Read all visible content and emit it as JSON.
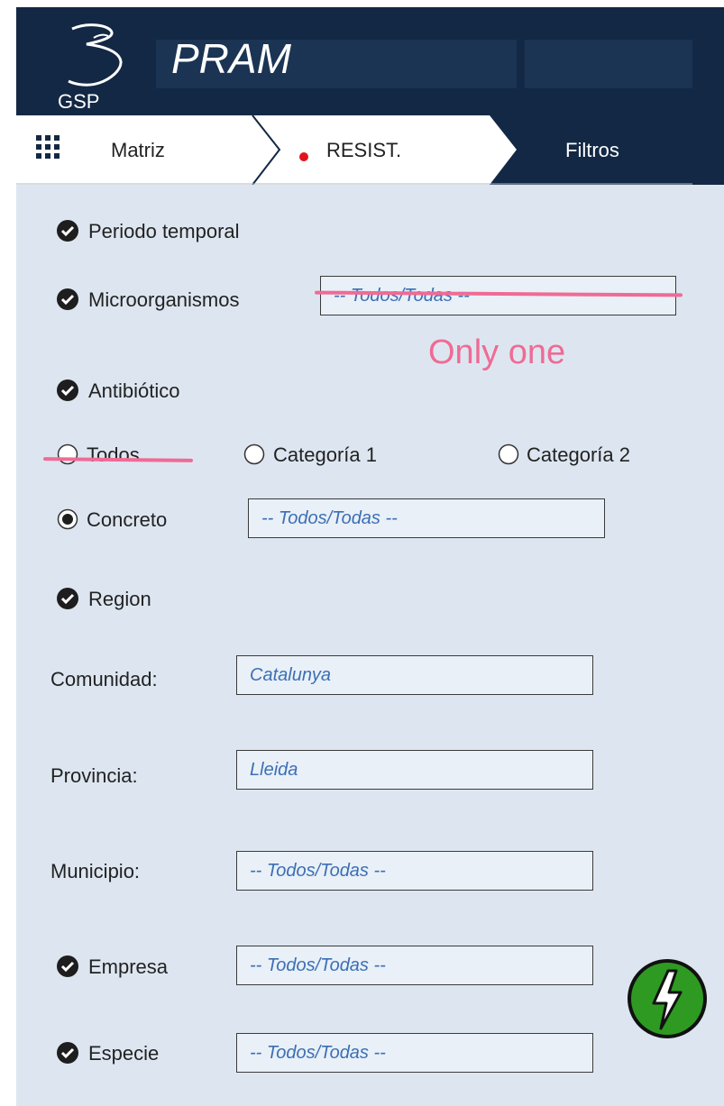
{
  "header": {
    "logo_text": "GSP",
    "title": "PRAM"
  },
  "breadcrumb": {
    "items": [
      {
        "label": "Matriz"
      },
      {
        "label": "RESIST."
      },
      {
        "label": "Filtros"
      }
    ]
  },
  "filters": {
    "periodo_label": "Periodo temporal",
    "microorganismos": {
      "label": "Microorganismos",
      "value": "-- Todos/Todas --"
    },
    "antibiotico_label": "Antibiótico",
    "antibiotico_options": [
      {
        "label": "Todos",
        "selected": false
      },
      {
        "label": "Categoría 1",
        "selected": false
      },
      {
        "label": "Categoría 2",
        "selected": false
      },
      {
        "label": "Concreto",
        "selected": true
      }
    ],
    "concreto_value": "-- Todos/Todas --",
    "region_label": "Region",
    "comunidad": {
      "label": "Comunidad:",
      "value": "Catalunya"
    },
    "provincia": {
      "label": "Provincia:",
      "value": "Lleida"
    },
    "municipio": {
      "label": "Municipio:",
      "value": "-- Todos/Todas --"
    },
    "empresa": {
      "label": "Empresa",
      "value": "-- Todos/Todas --"
    },
    "especie": {
      "label": "Especie",
      "value": "-- Todos/Todas --"
    }
  },
  "annotation": {
    "text": "Only one"
  },
  "colors": {
    "header_bg": "#132844",
    "panel_bg": "#dde6f0",
    "field_text": "#3c6fb4",
    "annotation": "#ef6b95",
    "action_button": "#2e9a22",
    "status_dot": "#e0151c"
  },
  "icons": {
    "logo": "gsp-logo-icon",
    "grid": "grid-menu-icon",
    "action": "lightning-bolt-icon"
  }
}
